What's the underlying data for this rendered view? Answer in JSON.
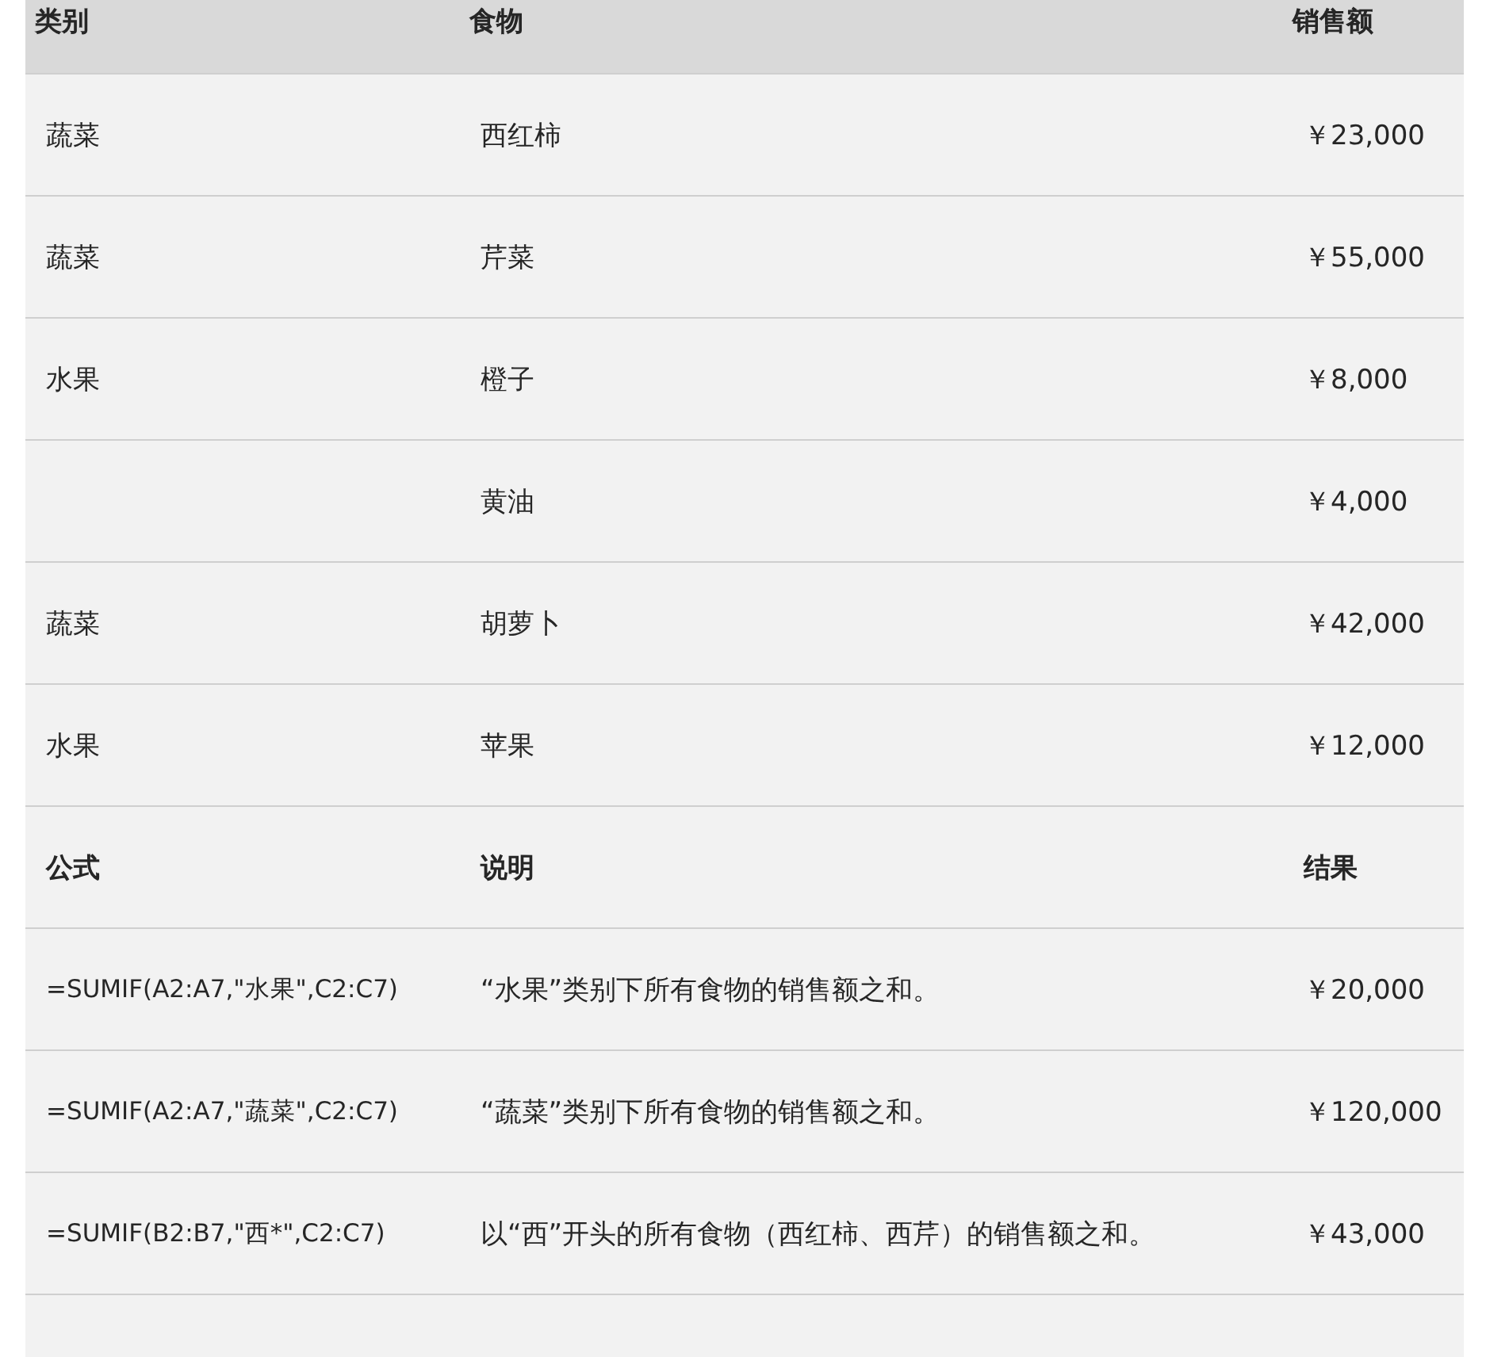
{
  "table": {
    "columns": [
      "类别",
      "食物",
      "销售额"
    ],
    "rows": [
      [
        "蔬菜",
        "西红柿",
        "￥23,000"
      ],
      [
        "蔬菜",
        "芹菜",
        "￥55,000"
      ],
      [
        "水果",
        "橙子",
        "￥8,000"
      ],
      [
        "",
        "黄油",
        "￥4,000"
      ],
      [
        "蔬菜",
        "胡萝卜",
        "￥42,000"
      ],
      [
        "水果",
        "苹果",
        "￥12,000"
      ]
    ]
  },
  "formulas": {
    "columns": [
      "公式",
      "说明",
      "结果"
    ],
    "rows": [
      [
        "=SUMIF(A2:A7,\"水果\",C2:C7)",
        "“水果”类别下所有食物的销售额之和。",
        "￥20,000"
      ],
      [
        "=SUMIF(A2:A7,\"蔬菜\",C2:C7)",
        "“蔬菜”类别下所有食物的销售额之和。",
        "￥120,000"
      ],
      [
        "=SUMIF(B2:B7,\"西*\",C2:C7)",
        "以“西”开头的所有食物（西红柿、西芹）的销售额之和。",
        "￥43,000"
      ]
    ]
  }
}
